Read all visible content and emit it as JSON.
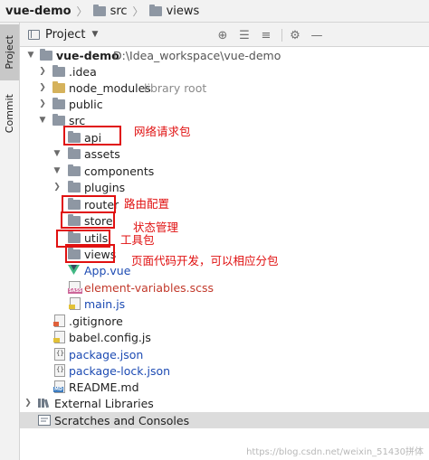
{
  "breadcrumb": {
    "items": [
      "vue-demo",
      "src",
      "views"
    ]
  },
  "side_strip": {
    "tabs": [
      "Project",
      "Commit"
    ]
  },
  "panel": {
    "title": "Project",
    "header_icons": [
      "locate-icon",
      "expand-all-icon",
      "collapse-all-icon",
      "settings-icon",
      "hide-icon"
    ]
  },
  "tree": {
    "root": {
      "name": "vue-demo",
      "path": "D:\\Idea_workspace\\vue-demo"
    },
    "idea": ".idea",
    "node_modules": {
      "name": "node_modules",
      "hint": "library root"
    },
    "public": "public",
    "src": "src",
    "api": "api",
    "assets": "assets",
    "components": "components",
    "plugins": "plugins",
    "router": "router",
    "store": "store",
    "utils": "utils",
    "views": "views",
    "app_vue": "App.vue",
    "element_variables": "element-variables.scss",
    "main_js": "main.js",
    "gitignore": ".gitignore",
    "babel_config": "babel.config.js",
    "package_json": "package.json",
    "package_lock": "package-lock.json",
    "readme": "README.md",
    "external_libraries": "External Libraries",
    "scratches": "Scratches and Consoles"
  },
  "annotations": {
    "api": "网络请求包",
    "router": "路由配置",
    "store": "状态管理",
    "utils": "工具包",
    "views": "页面代码开发，可以相应分包"
  },
  "watermark": "https://blog.csdn.net/weixin_51430拼体",
  "colors": {
    "annotation_red": "#e01010",
    "file_blue": "#1d4bb3",
    "scss_red": "#c2392b",
    "folder_gray": "#8e97a3",
    "folder_yellow": "#d5b25c"
  }
}
